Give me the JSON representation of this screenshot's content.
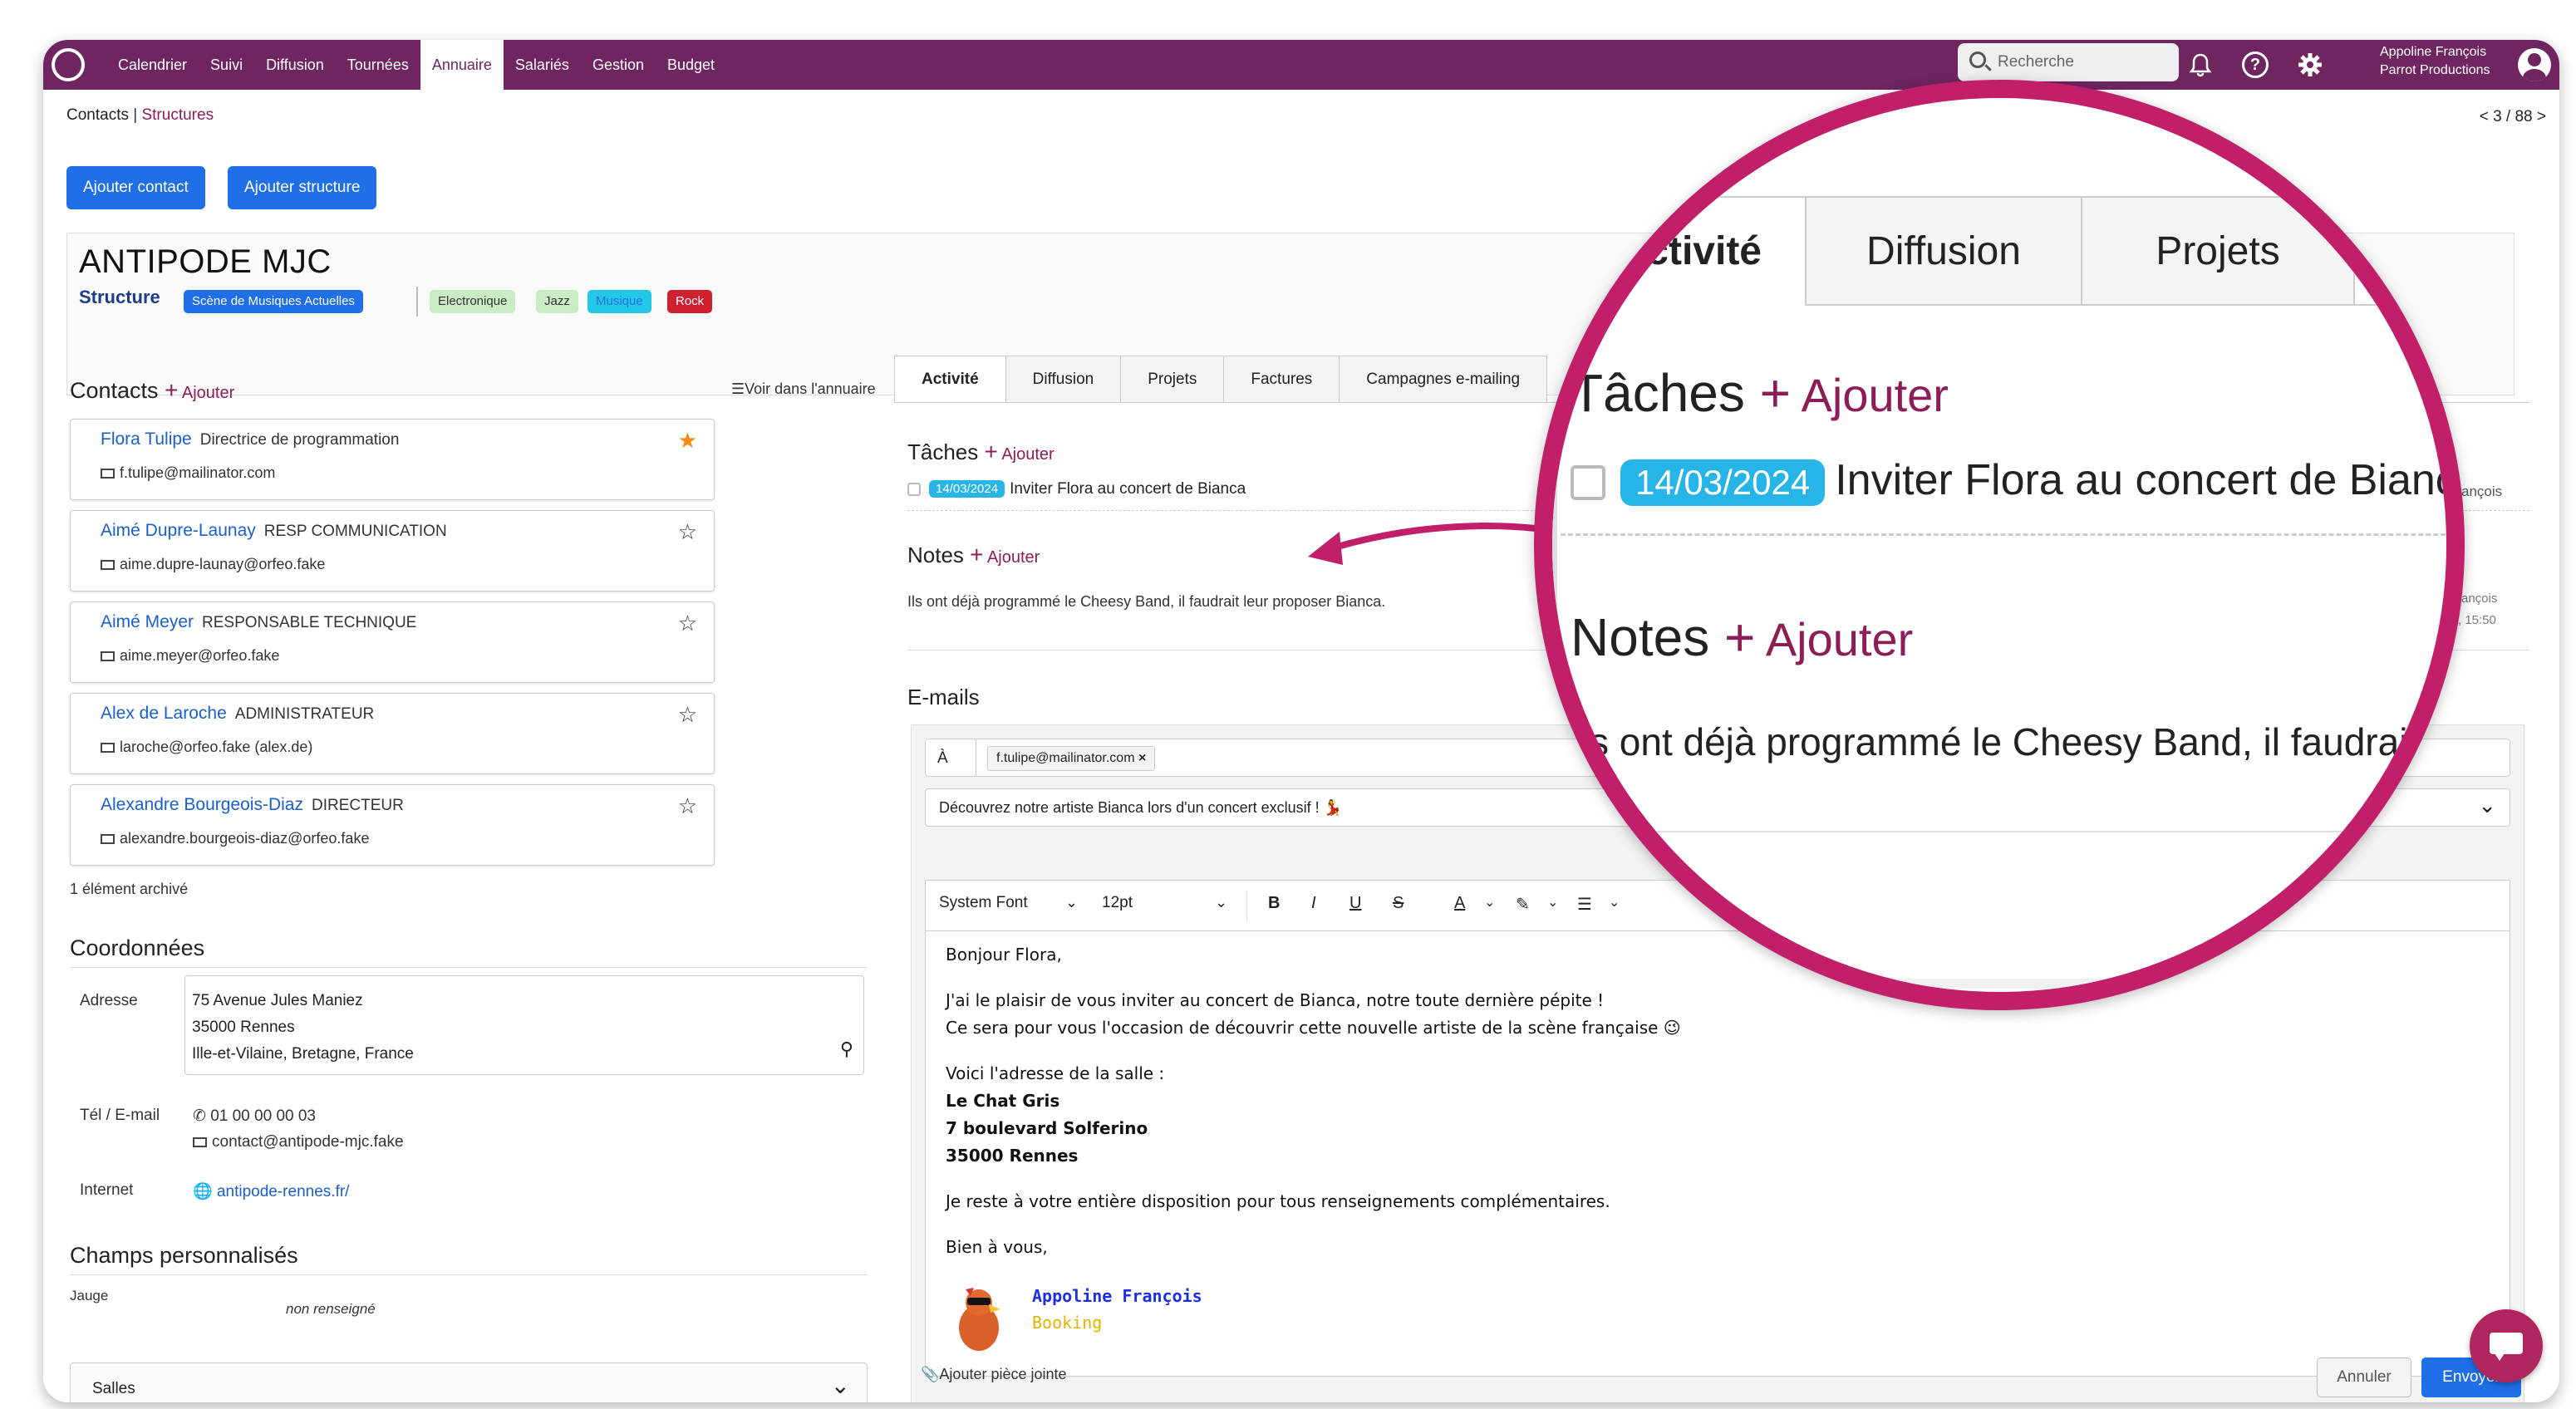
{
  "nav": {
    "items": [
      "Calendrier",
      "Suivi",
      "Diffusion",
      "Tournées",
      "Annuaire",
      "Salariés",
      "Gestion",
      "Budget"
    ],
    "active": "Annuaire",
    "search_placeholder": "Recherche",
    "user_name": "Appoline François",
    "user_company": "Parrot Productions"
  },
  "breadcrumb": {
    "first": "Contacts",
    "separator": "|",
    "current": "Structures"
  },
  "pager": "< 3 / 88 >",
  "buttons": {
    "add_contact": "Ajouter contact",
    "add_structure": "Ajouter structure"
  },
  "structure": {
    "name": "ANTIPODE MJC",
    "type": "Structure",
    "tags": [
      {
        "label": "Scène de Musiques Actuelles",
        "bg": "#1e6fe8",
        "fg": "#ffffff"
      },
      {
        "label": "Electronique",
        "bg": "#c9ecc4",
        "fg": "#333333"
      },
      {
        "label": "Jazz",
        "bg": "#c9ecc4",
        "fg": "#333333"
      },
      {
        "label": "Musique",
        "bg": "#22c8e6",
        "fg": "#1e6fe8"
      },
      {
        "label": "Rock",
        "bg": "#d01f2f",
        "fg": "#ffffff"
      }
    ]
  },
  "contacts_section": {
    "title": "Contacts",
    "add": "Ajouter",
    "view_directory": "Voir dans l'annuaire",
    "archived": "1 élément archivé",
    "items": [
      {
        "name": "Flora Tulipe",
        "role": "Directrice de programmation",
        "email": "f.tulipe@mailinator.com",
        "starred": true
      },
      {
        "name": "Aimé Dupre-Launay",
        "role": "RESP COMMUNICATION",
        "email": "aime.dupre-launay@orfeo.fake",
        "starred": false
      },
      {
        "name": "Aimé Meyer",
        "role": "RESPONSABLE TECHNIQUE",
        "email": "aime.meyer@orfeo.fake",
        "starred": false
      },
      {
        "name": "Alex de Laroche",
        "role": "ADMINISTRATEUR",
        "email": "laroche@orfeo.fake",
        "email_suffix": "(alex.de)",
        "starred": false
      },
      {
        "name": "Alexandre Bourgeois-Diaz",
        "role": "DIRECTEUR",
        "email": "alexandre.bourgeois-diaz@orfeo.fake",
        "starred": false
      }
    ]
  },
  "coords": {
    "title": "Coordonnées",
    "address_label": "Adresse",
    "address_lines": [
      "75 Avenue Jules Maniez",
      "35000 Rennes",
      "Ille-et-Vilaine, Bretagne, France"
    ],
    "phone_label": "Tél / E-mail",
    "phone": "01 00 00 00 03",
    "email": "contact@antipode-mjc.fake",
    "internet_label": "Internet",
    "website": "antipode-rennes.fr/"
  },
  "custom_fields": {
    "title": "Champs personnalisés",
    "field": "Jauge",
    "value": "non renseigné"
  },
  "salles": "Salles",
  "tabs": [
    "Activité",
    "Diffusion",
    "Projets",
    "Factures",
    "Campagnes e-mailing"
  ],
  "activity": {
    "tasks_title": "Tâches",
    "add": "Ajouter",
    "task_date": "14/03/2024",
    "task_text": "Inviter Flora au concert de Bianca",
    "notes_title": "Notes",
    "note_text": "Ils ont déjà programmé le Cheesy Band, il faudrait leur proposer Bianca.",
    "side_right": "ançois",
    "side_time": "ançois",
    "side_time2": ", 15:50",
    "emails_title": "E-mails"
  },
  "email": {
    "to_label": "À",
    "to_chip": "f.tulipe@mailinator.com",
    "subject": "Découvrez notre artiste Bianca  lors d'un concert exclusif ! 💃",
    "font": "System Font",
    "size": "12pt",
    "body": {
      "greeting": "Bonjour Flora,",
      "p1": "J'ai le plaisir de vous inviter au concert de Bianca, notre toute dernière pépite !",
      "p2": "Ce sera pour vous l'occasion de découvrir cette nouvelle artiste de la scène française 😉",
      "venue_intro": "Voici l'adresse de la salle :",
      "venue_name": "Le Chat Gris",
      "venue_street": "7 boulevard Solferino",
      "venue_city": "35000 Rennes",
      "p3": "Je reste à votre entière disposition pour tous renseignements complémentaires.",
      "closing": "Bien à vous,",
      "sig_name": "Appoline François",
      "sig_role": "Booking"
    },
    "attach": "Ajouter pièce jointe",
    "cancel": "Annuler",
    "send": "Envoyer"
  },
  "zoom": {
    "tab_activity_partial": "ctivité",
    "tab_diffusion": "Diffusion",
    "tab_projects": "Projets",
    "tasks_title": "Tâches",
    "add": "Ajouter",
    "task_date": "14/03/2024",
    "task_text": "Inviter Flora au concert de Bianca",
    "notes_title": "Notes",
    "note_text": "Ils ont déjà programmé le Cheesy Band, il faudrait l",
    "emails_partial": "ils"
  },
  "colors": {
    "brand": "#6f2560",
    "accent": "#8c1d56",
    "primary_button": "#1e6fe8",
    "zoom_ring": "#c11f6a",
    "arrow": "#c11f6a"
  }
}
